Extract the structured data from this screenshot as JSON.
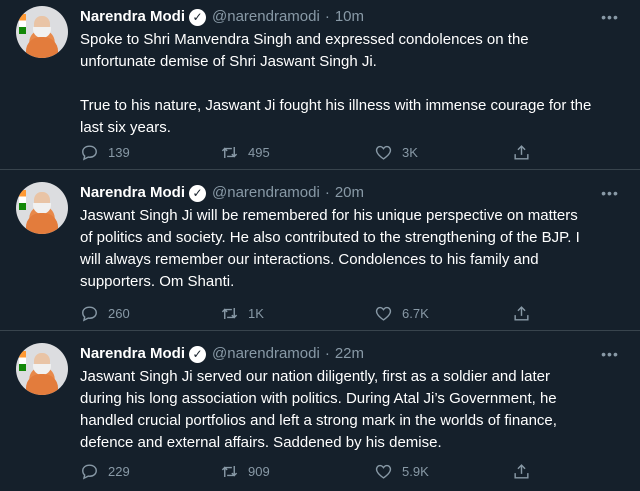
{
  "colors": {
    "background": "#15202b",
    "divider": "#38444d",
    "muted": "#8899a6",
    "text": "#ffffff"
  },
  "icons": {
    "verified": "verified-badge-icon",
    "more": "more-dots-icon",
    "reply": "reply-icon",
    "retweet": "retweet-icon",
    "like": "heart-icon",
    "share": "share-icon"
  },
  "tweets": [
    {
      "name": "Narendra Modi",
      "handle": "@narendramodi",
      "separator": "·",
      "time": "10m",
      "text": "Spoke to Shri Manvendra Singh and expressed condolences on the\nunfortunate demise of Shri Jaswant Singh Ji.\n\nTrue to his nature, Jaswant Ji fought his illness with immense courage for the\nlast six years.",
      "replies": "139",
      "retweets": "495",
      "likes": "3K"
    },
    {
      "name": "Narendra Modi",
      "handle": "@narendramodi",
      "separator": "·",
      "time": "20m",
      "text": "Jaswant Singh Ji will be remembered for his unique perspective on matters\nof politics and society. He also contributed to the strengthening of the BJP. I\nwill always remember our interactions. Condolences to his family and\nsupporters. Om Shanti.",
      "replies": "260",
      "retweets": "1K",
      "likes": "6.7K"
    },
    {
      "name": "Narendra Modi",
      "handle": "@narendramodi",
      "separator": "·",
      "time": "22m",
      "text": "Jaswant Singh Ji served our nation diligently, first as a soldier and later\nduring his long association with politics. During Atal Ji’s Government, he\nhandled crucial portfolios and left a strong mark in the worlds of finance,\ndefence and external affairs. Saddened by his demise.",
      "replies": "229",
      "retweets": "909",
      "likes": "5.9K"
    }
  ]
}
